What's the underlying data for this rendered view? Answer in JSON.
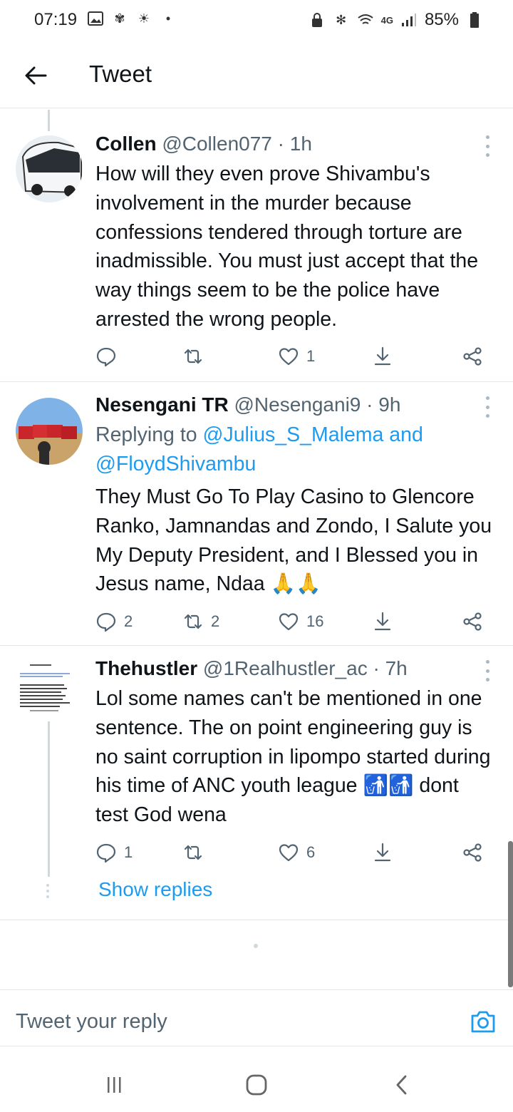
{
  "status_bar": {
    "time": "07:19",
    "network": "4G",
    "battery": "85%"
  },
  "header": {
    "title": "Tweet"
  },
  "tweets": [
    {
      "name": "Collen",
      "handle": "@Collen077",
      "time": "· 1h",
      "text": "How will they even prove Shivambu's involvement in the murder because confessions tendered through torture are inadmissible.  You must just accept that the way things seem to be the police have arrested the wrong people.",
      "replies": "",
      "retweets": "",
      "likes": "1"
    },
    {
      "name": "Nesengani TR",
      "handle": "@Nesengani9",
      "time": "· 9h",
      "replying_prefix": "Replying to ",
      "replying_users": "@Julius_S_Malema and @FloydShivambu",
      "text": "They Must Go To Play Casino to Glencore Ranko, Jamnandas and Zondo, I Salute you My Deputy President, and I Blessed you in Jesus name, Ndaa 🙏🙏",
      "replies": "2",
      "retweets": "2",
      "likes": "16"
    },
    {
      "name": "Thehustler",
      "handle": "@1Realhustler_ac",
      "time": "· 7h",
      "text": "Lol some names can't be mentioned in one sentence. The on point engineering guy is no saint corruption in lipompo started during his time of ANC youth league 🚮🚮 dont test God wena",
      "replies": "1",
      "retweets": "",
      "likes": "6"
    }
  ],
  "show_replies": "Show replies",
  "compose": {
    "placeholder": "Tweet your reply"
  },
  "colors": {
    "accent": "#1d9bf0",
    "secondary_text": "#536471",
    "primary_text": "#0f1419",
    "divider": "#e6e6e6"
  }
}
